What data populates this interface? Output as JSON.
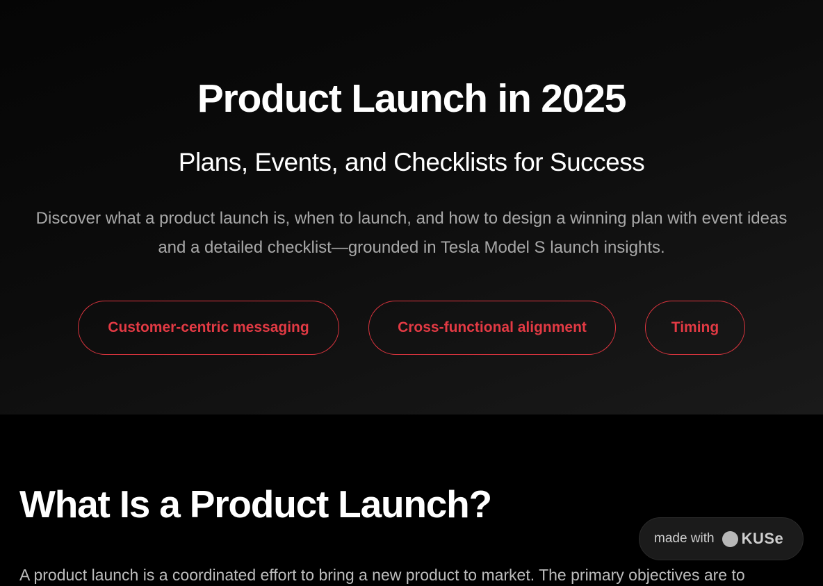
{
  "hero": {
    "title": "Product Launch in 2025",
    "subtitle": "Plans, Events, and Checklists for Success",
    "description": "Discover what a product launch is, when to launch, and how to design a winning plan with event ideas and a detailed checklist—grounded in Tesla Model S launch insights.",
    "pills": [
      {
        "label": "Customer-centric messaging"
      },
      {
        "label": "Cross-functional alignment"
      },
      {
        "label": "Timing"
      }
    ]
  },
  "section": {
    "title": "What Is a Product Launch?",
    "body": "A product launch is a coordinated effort to bring a new product to market. The primary objectives are to"
  },
  "badge": {
    "text": "made with",
    "logo_word": "KUSe",
    "icon": "kuse-logo-icon"
  },
  "colors": {
    "accent": "#e33a44",
    "background": "#000000",
    "hero_gradient_end": "#1a1a1a",
    "muted_text": "#a8a8a8"
  }
}
